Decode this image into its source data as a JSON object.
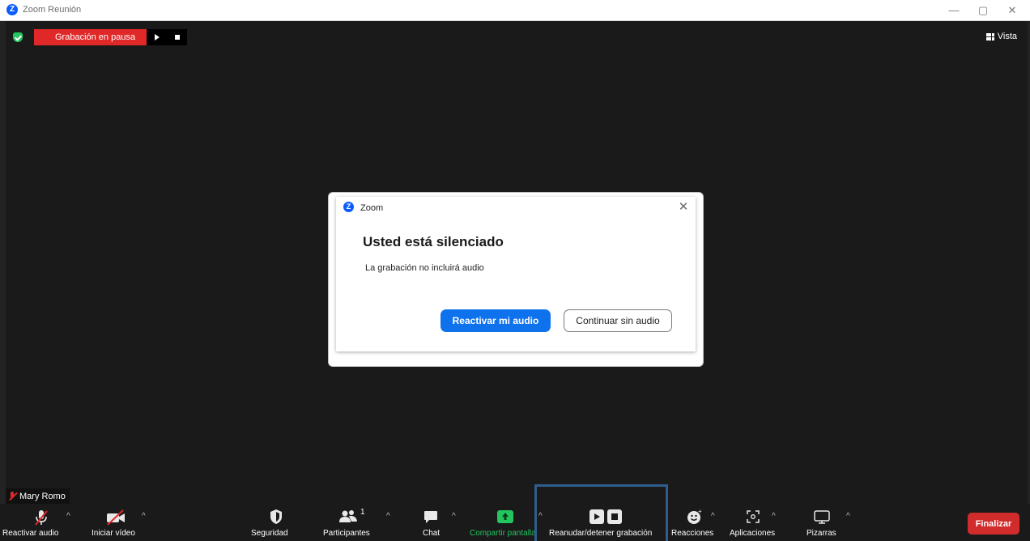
{
  "window": {
    "title": "Zoom Reunión",
    "app_icon": "Z"
  },
  "recording": {
    "label": "Grabación en pausa"
  },
  "view": {
    "label": "Vista"
  },
  "dialog": {
    "app_name": "Zoom",
    "icon": "Z",
    "heading": "Usted está silenciado",
    "message": "La grabación no incluirá audio",
    "primary_label": "Reactivar mi audio",
    "secondary_label": "Continuar sin audio"
  },
  "participant": {
    "name": "Mary Romo"
  },
  "toolbar": {
    "unmute": "Reactivar audio",
    "start_video": "Iniciar vídeo",
    "security": "Seguridad",
    "participants": "Participantes",
    "participants_count": "1",
    "chat": "Chat",
    "share": "Compartir pantalla",
    "record": "Reanudar/detener grabación",
    "reactions": "Reacciones",
    "apps": "Aplicaciones",
    "whiteboards": "Pizarras",
    "end": "Finalizar"
  },
  "colors": {
    "accent_blue": "#0e72ed",
    "end_red": "#d12c2c",
    "rec_red": "#e02828",
    "share_green": "#22c55e",
    "highlight": "#2f5d8f"
  }
}
